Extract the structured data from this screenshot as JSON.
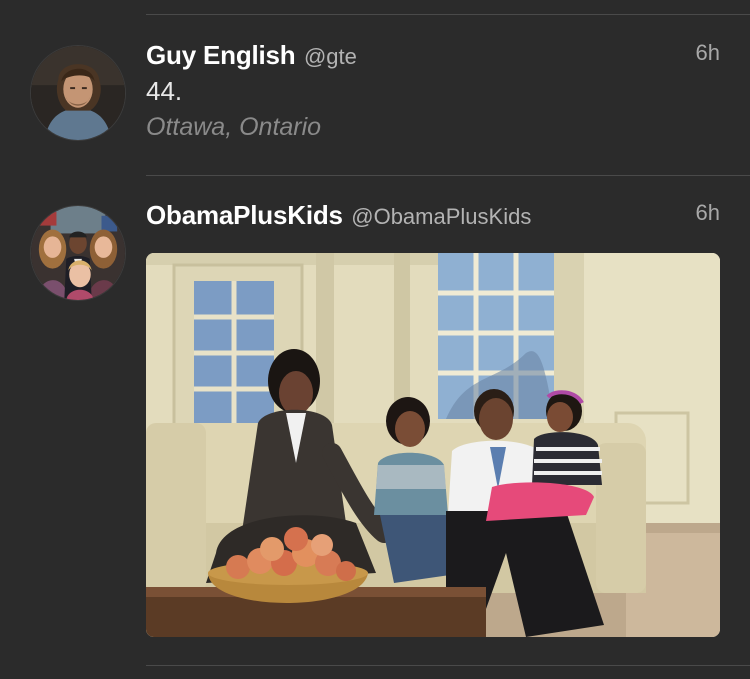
{
  "timeline": {
    "tweets": [
      {
        "display_name": "Guy English",
        "handle": "@gte",
        "timestamp": "6h",
        "text": "44.",
        "location": "Ottawa, Ontario",
        "avatar_icon": "person-avatar"
      },
      {
        "display_name": "ObamaPlusKids",
        "handle": "@ObamaPlusKids",
        "timestamp": "6h",
        "avatar_icon": "group-avatar",
        "media": {
          "type": "photo",
          "scene": "family-on-couch"
        }
      }
    ]
  },
  "colors": {
    "background": "#2b2b2b",
    "divider": "#4a4a4a",
    "name": "#ffffff",
    "handle": "#b3b3b3",
    "timestamp": "#a8a8a8",
    "location": "#8a8a8a"
  }
}
